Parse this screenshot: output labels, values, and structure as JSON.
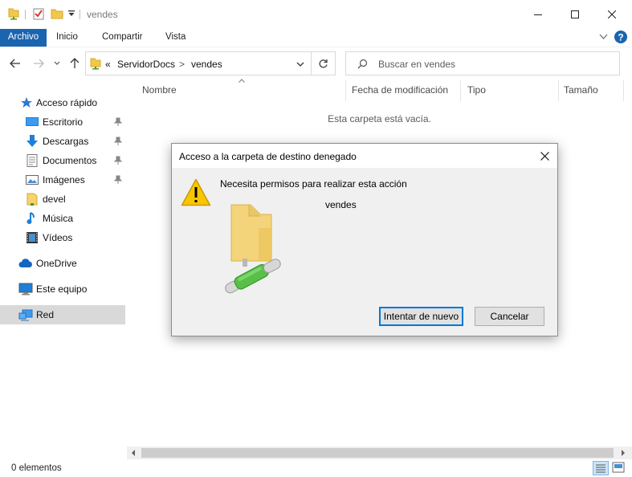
{
  "window": {
    "title": "vendes",
    "colors": {
      "ribbon_active": "#1a64b0",
      "help": "#1a64b0",
      "selection": "#d9d9d9"
    }
  },
  "ribbon": {
    "tabs": [
      {
        "label": "Archivo",
        "active": true
      },
      {
        "label": "Inicio"
      },
      {
        "label": "Compartir"
      },
      {
        "label": "Vista"
      }
    ]
  },
  "address": {
    "overflow": "«",
    "crumbs": [
      "ServidorDocs",
      "vendes"
    ],
    "separator": ">"
  },
  "search": {
    "placeholder": "Buscar en vendes"
  },
  "sidebar": {
    "items": [
      {
        "label": "Acceso rápido",
        "icon": "star-icon"
      },
      {
        "label": "Escritorio",
        "icon": "desktop-icon",
        "pinned": true
      },
      {
        "label": "Descargas",
        "icon": "download-icon",
        "pinned": true
      },
      {
        "label": "Documentos",
        "icon": "documents-icon",
        "pinned": true
      },
      {
        "label": "Imágenes",
        "icon": "pictures-icon",
        "pinned": true
      },
      {
        "label": "devel",
        "icon": "folder-icon"
      },
      {
        "label": "Música",
        "icon": "music-icon"
      },
      {
        "label": "Vídeos",
        "icon": "videos-icon"
      },
      {
        "label": "OneDrive",
        "icon": "cloud-icon"
      },
      {
        "label": "Este equipo",
        "icon": "computer-icon"
      },
      {
        "label": "Red",
        "icon": "network-icon",
        "selected": true
      }
    ]
  },
  "content": {
    "columns": [
      "Nombre",
      "Fecha de modificación",
      "Tipo",
      "Tamaño"
    ],
    "empty_message": "Esta carpeta está vacía."
  },
  "status": {
    "text": "0 elementos"
  },
  "dialog": {
    "title": "Acceso a la carpeta de destino denegado",
    "message": "Necesita permisos para realizar esta acción",
    "folder_name": "vendes",
    "retry_label": "Intentar de nuevo",
    "cancel_label": "Cancelar"
  }
}
